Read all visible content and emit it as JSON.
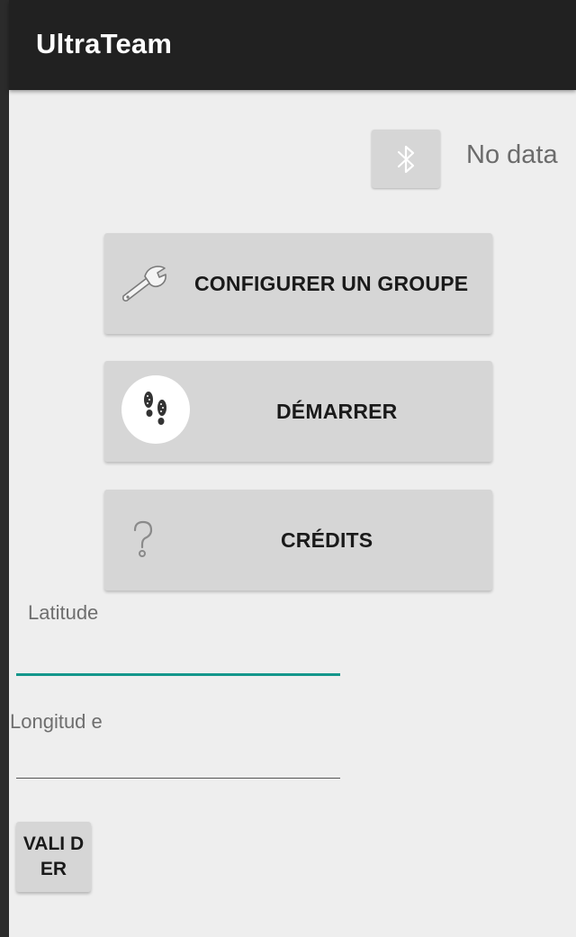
{
  "app": {
    "title": "UltraTeam"
  },
  "bluetooth": {
    "icon": "bluetooth-icon",
    "status": "No data"
  },
  "menu": {
    "configure": {
      "label": "CONFIGURER UN GROUPE",
      "icon": "wrench-icon"
    },
    "start": {
      "label": "DÉMARRER",
      "icon": "footprints-icon"
    },
    "credits": {
      "label": "CRÉDITS",
      "icon": "question-icon"
    }
  },
  "form": {
    "latitude_label": "Latitude",
    "longitude_label": "Longitud e",
    "submit_label": "VALI DER"
  },
  "colors": {
    "accent": "#13968b",
    "appbar": "#212121",
    "button": "#d6d6d6"
  }
}
